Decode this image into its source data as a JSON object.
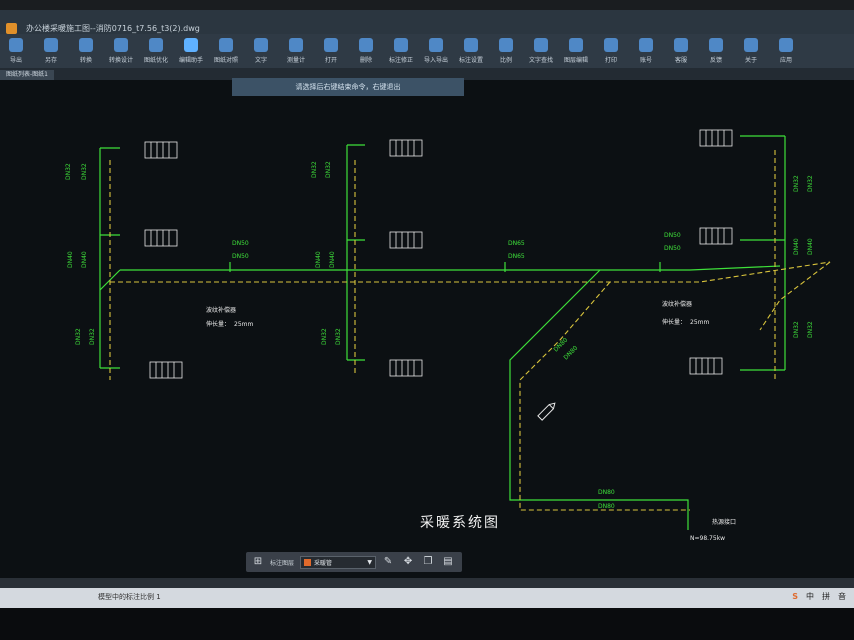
{
  "titlebar": {
    "title": "办公楼采暖施工图--消防0716_t7.56_t3(2).dwg"
  },
  "ribbon": {
    "buttons": [
      {
        "label": "导出"
      },
      {
        "label": "另存"
      },
      {
        "label": "转换"
      },
      {
        "label": "转换设计"
      },
      {
        "label": "图纸优化"
      },
      {
        "label": "编辑助手"
      },
      {
        "label": "图纸对照"
      },
      {
        "label": "文字"
      },
      {
        "label": "测量计"
      },
      {
        "label": "打开"
      },
      {
        "label": "删除"
      },
      {
        "label": "标注修正"
      },
      {
        "label": "导入导出"
      },
      {
        "label": "标注设置"
      },
      {
        "label": "比例"
      },
      {
        "label": "文字查找"
      },
      {
        "label": "图层编辑"
      },
      {
        "label": "打印"
      },
      {
        "label": "账号"
      },
      {
        "label": "客服"
      },
      {
        "label": "反馈"
      },
      {
        "label": "关于"
      },
      {
        "label": "应用"
      }
    ]
  },
  "doc_tab": {
    "label": "图纸列表-图纸1"
  },
  "command_tip": {
    "text": "请选择后右键结束命令，右键退出"
  },
  "drawing": {
    "title": "采暖系统图",
    "labels": {
      "dn32": "DN32",
      "dn40": "DN40",
      "dn50": "DN50",
      "dn65": "DN65",
      "dn80": "DN80",
      "fixed_bracket": "波纹补偿器",
      "comp_amount": "伸长量：",
      "comp_value": "25mm",
      "heat_source": "热源接口",
      "load": "N=98.75kw"
    }
  },
  "floating_toolbar": {
    "mode_label": "标注图层",
    "layer_name": "采暖管",
    "buttons": [
      "grid-icon",
      "edit-icon",
      "move-icon",
      "copy-icon",
      "layers-icon"
    ]
  },
  "status": {
    "command": "模型中的标注比例 1",
    "tray": [
      "中",
      "拼",
      "音"
    ]
  },
  "colors": {
    "pipe_supply": "#3ee03a",
    "pipe_return": "#d9c43c",
    "radiator": "#e8e8e8",
    "canvas": "#0c1013",
    "ribbon": "#2f3a45"
  }
}
